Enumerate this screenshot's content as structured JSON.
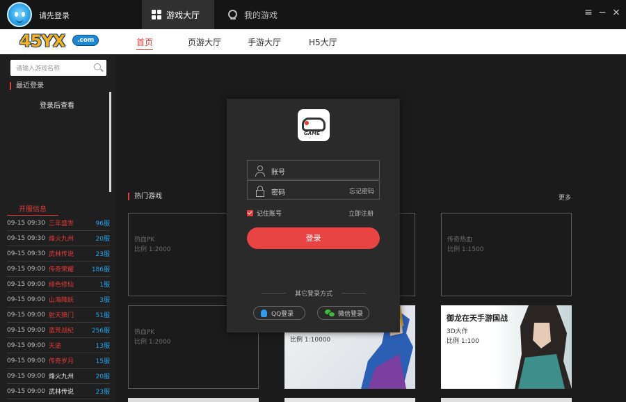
{
  "titlebar": {
    "login_hint": "请先登录",
    "tabs": [
      {
        "label": "游戏大厅",
        "active": true,
        "icon": "grid-icon"
      },
      {
        "label": "我的游戏",
        "active": false,
        "icon": "webcam-icon"
      }
    ],
    "controls": {
      "menu": "≡",
      "minimize": "−",
      "close": "×"
    }
  },
  "nav": {
    "logo_text": "45YX",
    "logo_suffix": ".com",
    "links": [
      {
        "label": "首页",
        "active": true
      },
      {
        "label": "页游大厅",
        "active": false
      },
      {
        "label": "手游大厅",
        "active": false
      },
      {
        "label": "H5大厅",
        "active": false
      }
    ]
  },
  "sidebar": {
    "search_placeholder": "请输入游戏名称",
    "recent_title": "最近登录",
    "recent_empty": "登录后查看",
    "servers_title": "开服信息",
    "servers": [
      {
        "time": "09-15 09:30",
        "game": "三年盛世",
        "server": "96服",
        "highlight": false
      },
      {
        "time": "09-15 09:30",
        "game": "烽火九州",
        "server": "20服",
        "highlight": false
      },
      {
        "time": "09-15 09:30",
        "game": "武林传说",
        "server": "23服",
        "highlight": false
      },
      {
        "time": "09-15 09:00",
        "game": "传奇荣耀",
        "server": "186服",
        "highlight": false
      },
      {
        "time": "09-15 09:00",
        "game": "绯色修仙",
        "server": "1服",
        "highlight": false
      },
      {
        "time": "09-15 09:00",
        "game": "山海降妖",
        "server": "3服",
        "highlight": false
      },
      {
        "time": "09-15 09:00",
        "game": "射天狼门",
        "server": "51服",
        "highlight": false
      },
      {
        "time": "09-15 09:00",
        "game": "蛮荒战纪",
        "server": "256服",
        "highlight": false
      },
      {
        "time": "09-15 09:00",
        "game": "天途",
        "server": "13服",
        "highlight": false
      },
      {
        "time": "09-15 09:00",
        "game": "传奇岁月",
        "server": "15服",
        "highlight": false
      },
      {
        "time": "09-15 09:00",
        "game": "烽火九州",
        "server": "20服",
        "highlight": true
      },
      {
        "time": "09-15 09:00",
        "game": "武林传说",
        "server": "23服",
        "highlight": true
      }
    ]
  },
  "main": {
    "hot_title": "热门游戏",
    "more": "更多",
    "cards": [
      {
        "title": "热血PK",
        "ratio": "比例 1:2000"
      },
      {
        "title": "传奇热血",
        "ratio": "比例 1:1500"
      },
      {
        "title": "热血PK",
        "ratio": "比例 1:2000"
      },
      {
        "title": "",
        "ratio": "比例 1:10000"
      },
      {
        "title": "御龙在天手游国战",
        "sub": "3D大作",
        "ratio": "比例 1:100"
      }
    ]
  },
  "modal": {
    "logo_text": "GAME",
    "account_placeholder": "账号",
    "password_placeholder": "密码",
    "forgot": "忘记密码",
    "remember": "记住账号",
    "register": "立即注册",
    "login_button": "登录",
    "other_login": "其它登录方式",
    "qq_login": "QQ登录",
    "wechat_login": "微信登录"
  },
  "colors": {
    "accent": "#e84444",
    "server_blue": "#28a2e8",
    "server_red": "#e53a3a"
  }
}
